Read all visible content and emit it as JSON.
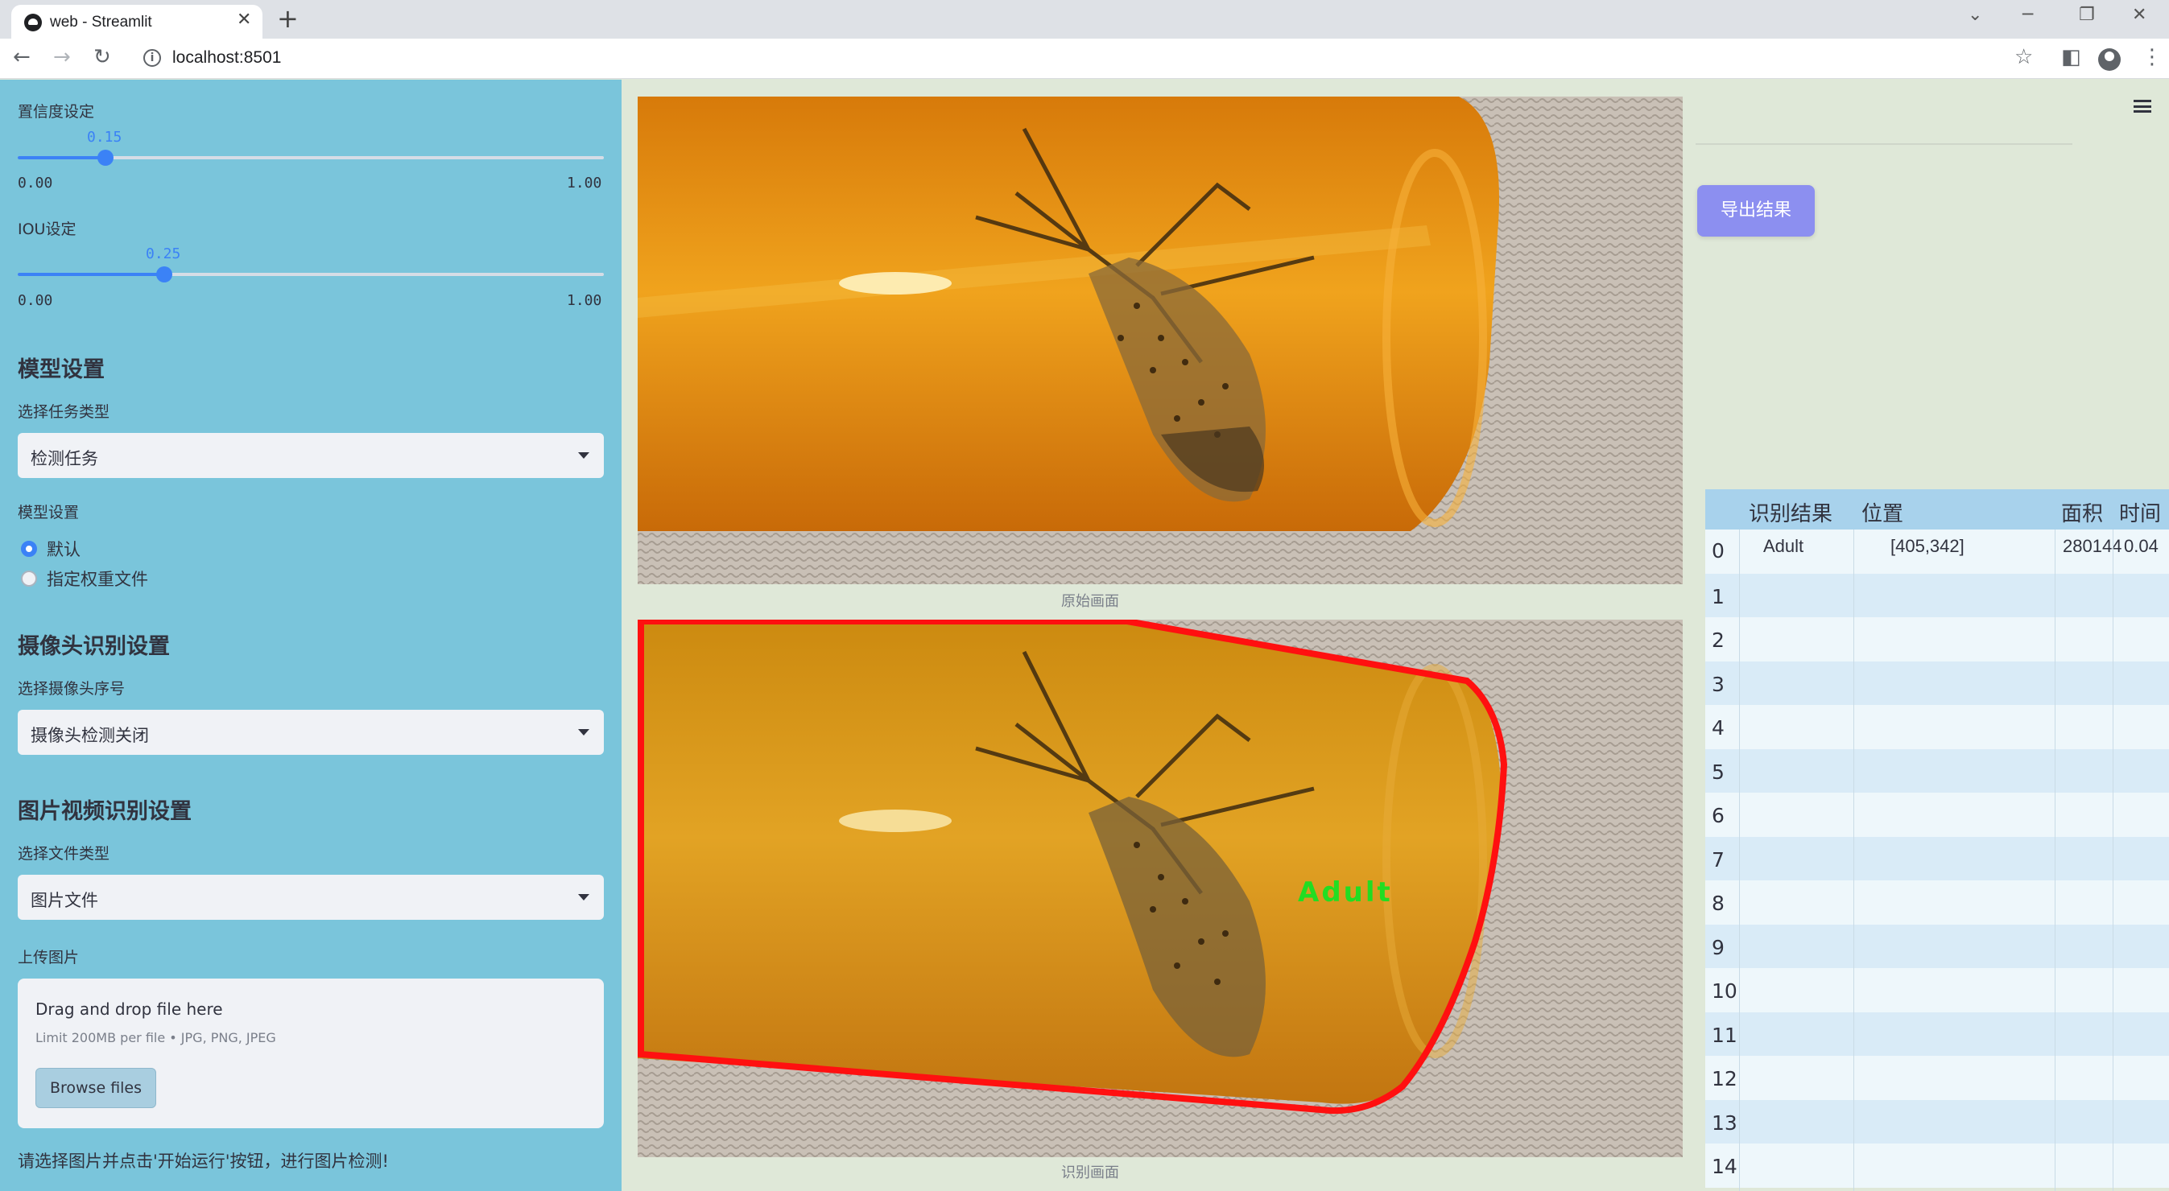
{
  "browser": {
    "tab_title": "web - Streamlit",
    "url": "localhost:8501"
  },
  "sidebar": {
    "confidence": {
      "label": "置信度设定",
      "value": "0.15",
      "min": "0.00",
      "max": "1.00",
      "fraction": 0.15
    },
    "iou": {
      "label": "IOU设定",
      "value": "0.25",
      "min": "0.00",
      "max": "1.00",
      "fraction": 0.25
    },
    "model_section": "模型设置",
    "task_label": "选择任务类型",
    "task_value": "检测任务",
    "model_label": "模型设置",
    "model_options": [
      "默认",
      "指定权重文件"
    ],
    "model_selected": 0,
    "camera_section": "摄像头识别设置",
    "camera_label": "选择摄像头序号",
    "camera_value": "摄像头检测关闭",
    "file_section": "图片视频识别设置",
    "file_type_label": "选择文件类型",
    "file_type_value": "图片文件",
    "upload_label": "上传图片",
    "upload_title": "Drag and drop file here",
    "upload_hint": "Limit 200MB per file • JPG, PNG, JPEG",
    "browse_label": "Browse files",
    "note": "请选择图片并点击'开始运行'按钮，进行图片检测!"
  },
  "main": {
    "original_caption": "原始画面",
    "result_caption": "识别画面",
    "detection_label": "Adult",
    "export_label": "导出结果"
  },
  "table": {
    "headers": [
      "识别结果",
      "位置",
      "面积",
      "时间"
    ],
    "rows": [
      {
        "index": "0",
        "result": "Adult",
        "position": "[405,342]",
        "area": "280144",
        "time": "0.04"
      },
      {
        "index": "1"
      },
      {
        "index": "2"
      },
      {
        "index": "3"
      },
      {
        "index": "4"
      },
      {
        "index": "5"
      },
      {
        "index": "6"
      },
      {
        "index": "7"
      },
      {
        "index": "8"
      },
      {
        "index": "9"
      },
      {
        "index": "10"
      },
      {
        "index": "11"
      },
      {
        "index": "12"
      },
      {
        "index": "13"
      },
      {
        "index": "14"
      }
    ]
  },
  "colors": {
    "sidebar_bg": "#7ac5db",
    "accent": "#3b82f6",
    "export_button": "#8c8ff0",
    "detection_box": "#ff1010",
    "detection_label": "#22dd22"
  }
}
